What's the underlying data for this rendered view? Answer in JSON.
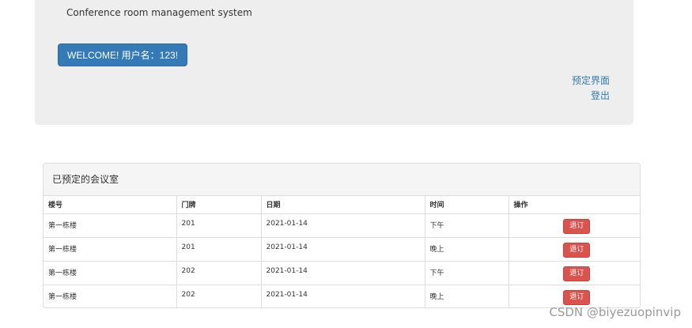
{
  "header": {
    "subtitle": "Conference room management system",
    "welcome_label": "WELCOME! 用户名：123!",
    "links": {
      "booking": "预定界面",
      "logout": "登出"
    }
  },
  "panel": {
    "title": "已预定的会议室",
    "columns": {
      "building": "楼号",
      "door": "门牌",
      "date": "日期",
      "time": "时间",
      "action": "操作"
    },
    "rows": [
      {
        "building": "第一栋楼",
        "door": "201",
        "date": "2021-01-14",
        "time": "下午",
        "action": "退订"
      },
      {
        "building": "第一栋楼",
        "door": "201",
        "date": "2021-01-14",
        "time": "晚上",
        "action": "退订"
      },
      {
        "building": "第一栋楼",
        "door": "202",
        "date": "2021-01-14",
        "time": "下午",
        "action": "退订"
      },
      {
        "building": "第一栋楼",
        "door": "202",
        "date": "2021-01-14",
        "time": "晚上",
        "action": "退订"
      }
    ]
  },
  "watermark": "CSDN @biyezuopinvip",
  "colors": {
    "primary": "#337ab7",
    "danger": "#d9534f",
    "jumbotron_bg": "#eeeeee"
  }
}
